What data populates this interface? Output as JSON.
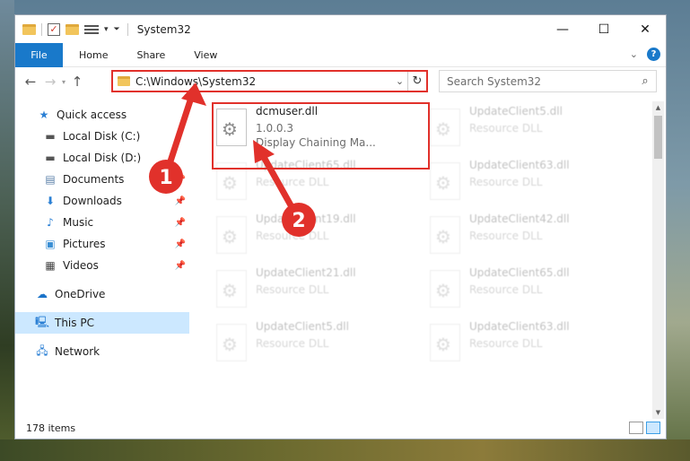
{
  "window": {
    "title": "System32",
    "controls": {
      "minimize": "—",
      "maximize": "☐",
      "close": "✕"
    }
  },
  "ribbon": {
    "tabs": [
      {
        "label": "File",
        "active": true
      },
      {
        "label": "Home"
      },
      {
        "label": "Share"
      },
      {
        "label": "View"
      }
    ],
    "help": "?"
  },
  "address_bar": {
    "path": "C:\\Windows\\System32",
    "search_placeholder": "Search System32"
  },
  "nav_pane": {
    "items": [
      {
        "label": "Quick access",
        "icon": "star-icon",
        "pinned": false
      },
      {
        "label": "Local Disk (C:)",
        "icon": "drive-icon",
        "pinned": false
      },
      {
        "label": "Local Disk (D:)",
        "icon": "drive-icon",
        "pinned": false
      },
      {
        "label": "Documents",
        "icon": "documents-icon",
        "pinned": true
      },
      {
        "label": "Downloads",
        "icon": "downloads-icon",
        "pinned": true
      },
      {
        "label": "Music",
        "icon": "music-icon",
        "pinned": true
      },
      {
        "label": "Pictures",
        "icon": "pictures-icon",
        "pinned": true
      },
      {
        "label": "Videos",
        "icon": "videos-icon",
        "pinned": true
      },
      {
        "label": "OneDrive",
        "icon": "onedrive-icon",
        "pinned": false
      },
      {
        "label": "This PC",
        "icon": "this-pc-icon",
        "pinned": false,
        "selected": true
      },
      {
        "label": "Network",
        "icon": "network-icon",
        "pinned": false
      }
    ]
  },
  "files": [
    {
      "name": "dcmuser.dll",
      "line2": "1.0.0.3",
      "line3": "Display Chaining Ma...",
      "highlighted": true
    },
    {
      "name": "UpdateClient5.dll",
      "line2": "Resource DLL"
    },
    {
      "name": "UpdateClient65.dll",
      "line2": "Resource DLL"
    },
    {
      "name": "UpdateClient63.dll",
      "line2": "Resource DLL"
    },
    {
      "name": "UpdateClient19.dll",
      "line2": "Resource DLL"
    },
    {
      "name": "UpdateClient42.dll",
      "line2": "Resource DLL"
    },
    {
      "name": "UpdateClient21.dll",
      "line2": "Resource DLL"
    },
    {
      "name": "UpdateClient65.dll",
      "line2": "Resource DLL"
    },
    {
      "name": "UpdateClient5.dll",
      "line2": "Resource DLL"
    },
    {
      "name": "UpdateClient63.dll",
      "line2": "Resource DLL"
    }
  ],
  "status": {
    "item_count": "178 items"
  },
  "annotations": {
    "step1": "1",
    "step2": "2",
    "color": "#e1312b"
  }
}
